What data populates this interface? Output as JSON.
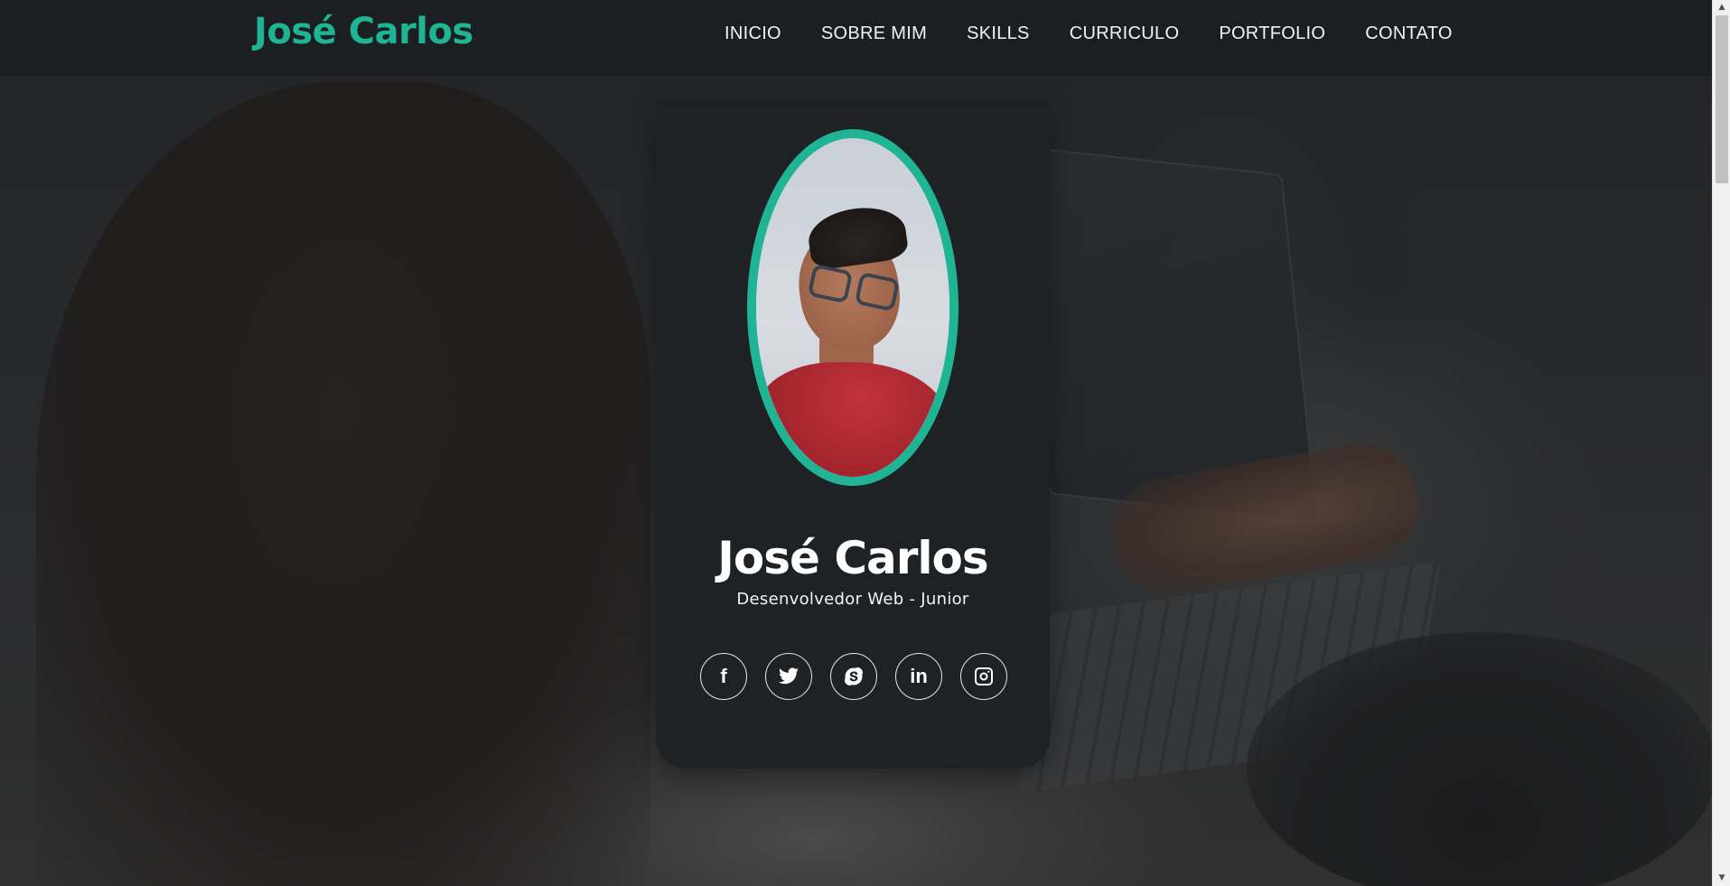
{
  "header": {
    "brand": "José Carlos",
    "nav": [
      {
        "label": "INICIO"
      },
      {
        "label": "SOBRE MIM"
      },
      {
        "label": "SKILLS"
      },
      {
        "label": "CURRICULO"
      },
      {
        "label": "PORTFOLIO"
      },
      {
        "label": "CONTATO"
      }
    ]
  },
  "profile": {
    "name": "José Carlos",
    "role": "Desenvolvedor Web - Junior",
    "photo_icon": "profile-photo",
    "social": [
      {
        "icon": "facebook-icon",
        "glyph": "f"
      },
      {
        "icon": "twitter-icon"
      },
      {
        "icon": "skype-icon"
      },
      {
        "icon": "linkedin-icon",
        "glyph": "in"
      },
      {
        "icon": "instagram-icon"
      }
    ]
  },
  "colors": {
    "accent": "#1fb594",
    "card": "#1f2224",
    "navbar": "#1c1f21",
    "text": "#ffffff"
  }
}
